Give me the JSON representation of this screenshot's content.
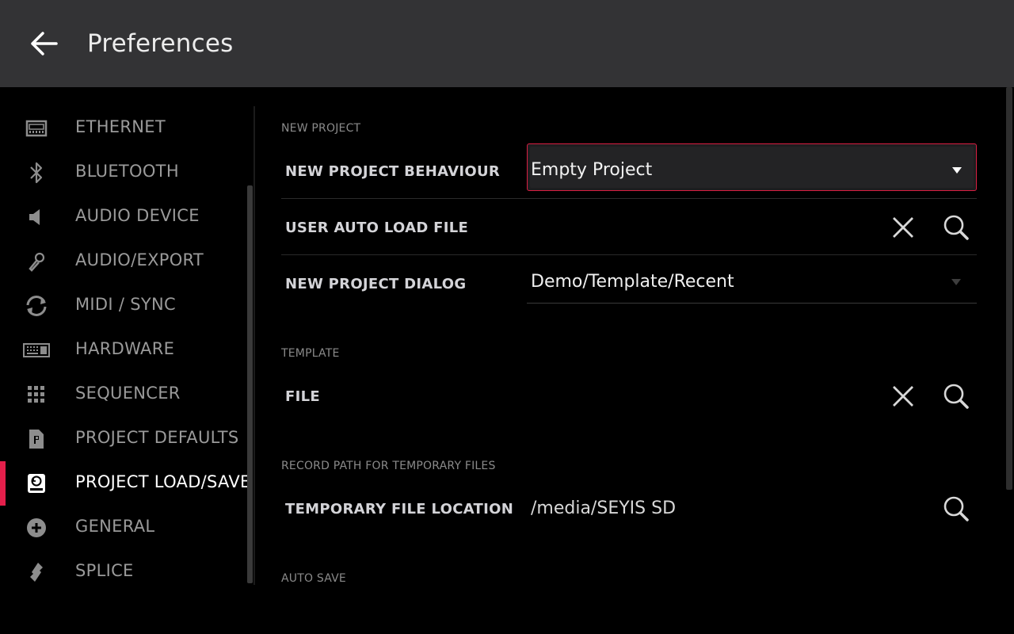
{
  "header": {
    "title": "Preferences",
    "back_icon": "arrow-left-icon"
  },
  "sidebar": {
    "items": [
      {
        "label": "ETHERNET",
        "icon": "ethernet-icon"
      },
      {
        "label": "BLUETOOTH",
        "icon": "bluetooth-icon"
      },
      {
        "label": "AUDIO DEVICE",
        "icon": "speaker-icon"
      },
      {
        "label": "AUDIO/EXPORT",
        "icon": "microphone-icon"
      },
      {
        "label": "MIDI / SYNC",
        "icon": "sync-icon"
      },
      {
        "label": "HARDWARE",
        "icon": "keyboard-icon"
      },
      {
        "label": "SEQUENCER",
        "icon": "grid-icon"
      },
      {
        "label": "PROJECT DEFAULTS",
        "icon": "document-icon"
      },
      {
        "label": "PROJECT LOAD/SAVE",
        "icon": "drive-icon",
        "active": true
      },
      {
        "label": "GENERAL",
        "icon": "plus-circle-icon"
      },
      {
        "label": "SPLICE",
        "icon": "splice-icon"
      }
    ],
    "accent_color": "#e41f4b"
  },
  "main": {
    "sections": {
      "new_project": "NEW PROJECT",
      "template": "TEMPLATE",
      "record_path": "RECORD PATH FOR TEMPORARY FILES",
      "auto_save": "AUTO SAVE"
    },
    "rows": {
      "new_project_behaviour": {
        "label": "NEW PROJECT BEHAVIOUR",
        "value": "Empty Project"
      },
      "user_auto_load_file": {
        "label": "USER AUTO LOAD FILE"
      },
      "new_project_dialog": {
        "label": "NEW PROJECT DIALOG",
        "value": "Demo/Template/Recent"
      },
      "file": {
        "label": "FILE"
      },
      "temporary_file_location": {
        "label": "TEMPORARY FILE LOCATION",
        "value": "/media/SEYIS SD"
      }
    }
  }
}
